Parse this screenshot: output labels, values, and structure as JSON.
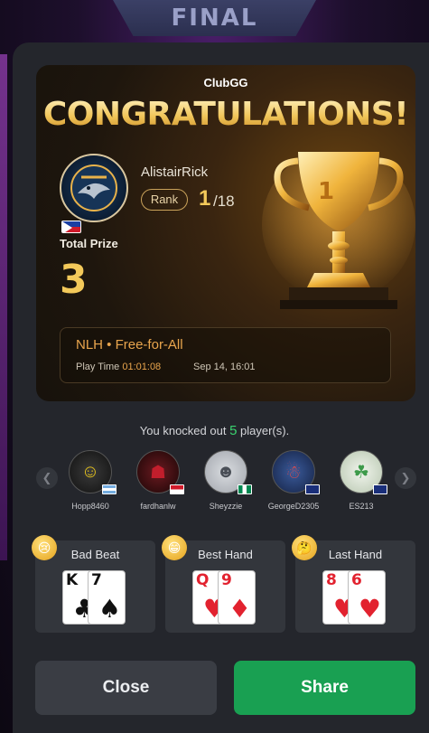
{
  "background": {
    "banner_text": "FINAL"
  },
  "hero": {
    "brand": "ClubGG",
    "congrats": "CONGRATULATIONS!",
    "username": "AlistairRick",
    "avatar_icon": "shark-team-logo-icon",
    "avatar_flag": "philippines-flag-icon",
    "rank_label": "Rank",
    "rank_value": "1",
    "rank_total": "/18",
    "prize_label": "Total Prize",
    "prize_value": "3",
    "trophy_icon": "gold-trophy-icon"
  },
  "event": {
    "title": "NLH • Free-for-All",
    "play_time_label": "Play Time",
    "play_time_value": "01:01:08",
    "date": "Sep 14, 16:01"
  },
  "knockouts": {
    "prefix": "You knocked out ",
    "count": "5",
    "suffix": " player(s).",
    "players": [
      {
        "name": "Hopp8460",
        "avatar_color": "#1a1a1a",
        "accent": "#e5c21c",
        "flag": "argentina-flag-icon"
      },
      {
        "name": "fardhanlw",
        "avatar_color": "#3a0d10",
        "accent": "#c21e2c",
        "flag": "indonesia-flag-icon"
      },
      {
        "name": "Sheyzzie",
        "avatar_color": "#c9ccd1",
        "accent": "#4a4f57",
        "flag": "nigeria-flag-icon"
      },
      {
        "name": "GeorgeD2305",
        "avatar_color": "#263a66",
        "accent": "#e04a4a",
        "flag": "australia-flag-icon"
      },
      {
        "name": "ES213",
        "avatar_color": "#dfe8d8",
        "accent": "#3d9a4a",
        "flag": "australia-flag-icon"
      }
    ]
  },
  "hands": [
    {
      "title": "Bad Beat",
      "emoji": "crying-face-icon",
      "cards": [
        {
          "rank": "K",
          "suit": "♣",
          "color": "blk"
        },
        {
          "rank": "7",
          "suit": "♠",
          "color": "blk"
        }
      ]
    },
    {
      "title": "Best Hand",
      "emoji": "grinning-face-icon",
      "cards": [
        {
          "rank": "Q",
          "suit": "♥",
          "color": "red"
        },
        {
          "rank": "9",
          "suit": "♦",
          "color": "red"
        }
      ]
    },
    {
      "title": "Last Hand",
      "emoji": "thinking-face-icon",
      "cards": [
        {
          "rank": "8",
          "suit": "♥",
          "color": "red"
        },
        {
          "rank": "6",
          "suit": "♥",
          "color": "red"
        }
      ]
    }
  ],
  "actions": {
    "close_label": "Close",
    "share_label": "Share"
  }
}
